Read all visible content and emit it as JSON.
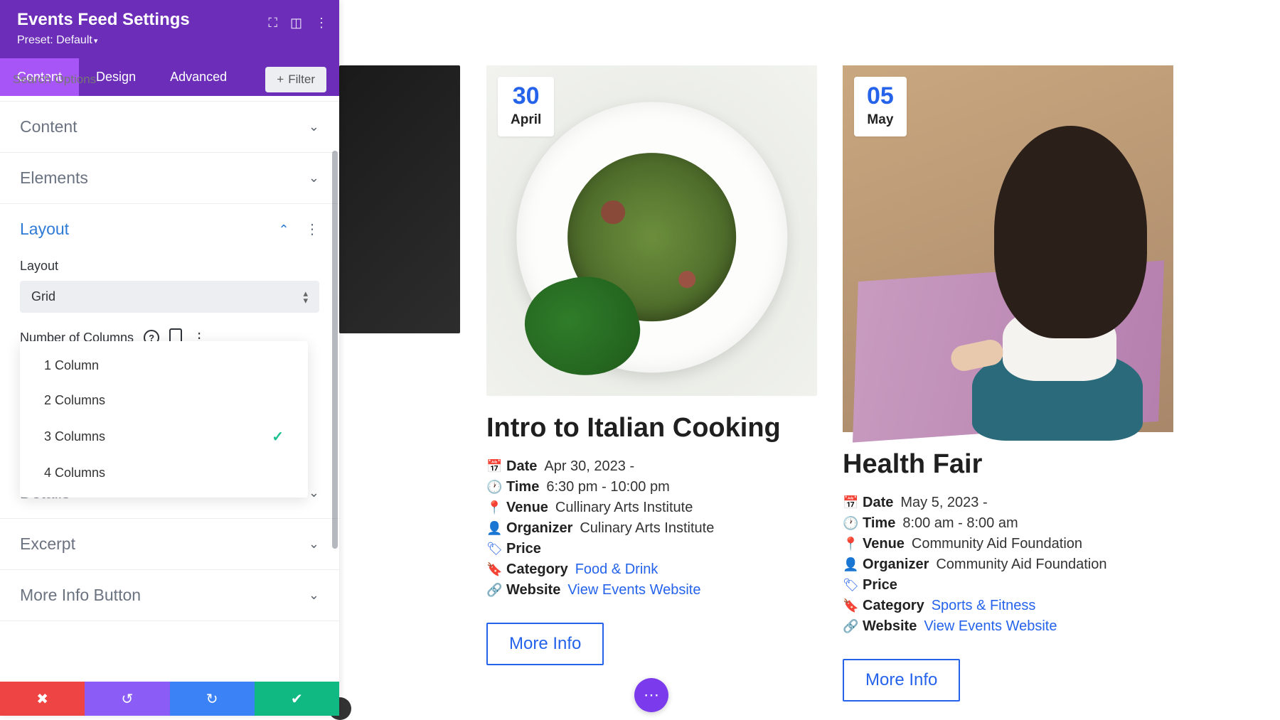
{
  "panel": {
    "title": "Events Feed Settings",
    "preset": "Preset: Default",
    "tabs": {
      "content": "Content",
      "design": "Design",
      "advanced": "Advanced"
    },
    "search_placeholder": "Search Options",
    "filter_label": "Filter",
    "sections": {
      "content": "Content",
      "elements": "Elements",
      "layout": "Layout",
      "details": "Details",
      "excerpt": "Excerpt",
      "more_info": "More Info Button"
    },
    "layout_field_label": "Layout",
    "layout_value": "Grid",
    "cols_label": "Number of Columns",
    "col_options": [
      "1 Column",
      "2 Columns",
      "3 Columns",
      "4 Columns"
    ],
    "col_selected_index": 2
  },
  "labels": {
    "date": "Date",
    "time": "Time",
    "venue": "Venue",
    "organizer": "Organizer",
    "price": "Price",
    "category": "Category",
    "website": "Website",
    "website_link": "View Events Website",
    "more_info": "More Info"
  },
  "events": [
    {
      "day": "30",
      "month": "April",
      "title": "Intro to Italian Cooking",
      "date": "Apr 30, 2023 -",
      "time": "6:30 pm - 10:00 pm",
      "venue": "Cullinary Arts Institute",
      "organizer": "Culinary Arts Institute",
      "price": "",
      "category": "Food & Drink"
    },
    {
      "day": "05",
      "month": "May",
      "title": "Health Fair",
      "date": "May 5, 2023 -",
      "time": "8:00 am - 8:00 am",
      "venue": "Community Aid Foundation",
      "organizer": "Community Aid Foundation",
      "price": "",
      "category": "Sports & Fitness"
    }
  ]
}
